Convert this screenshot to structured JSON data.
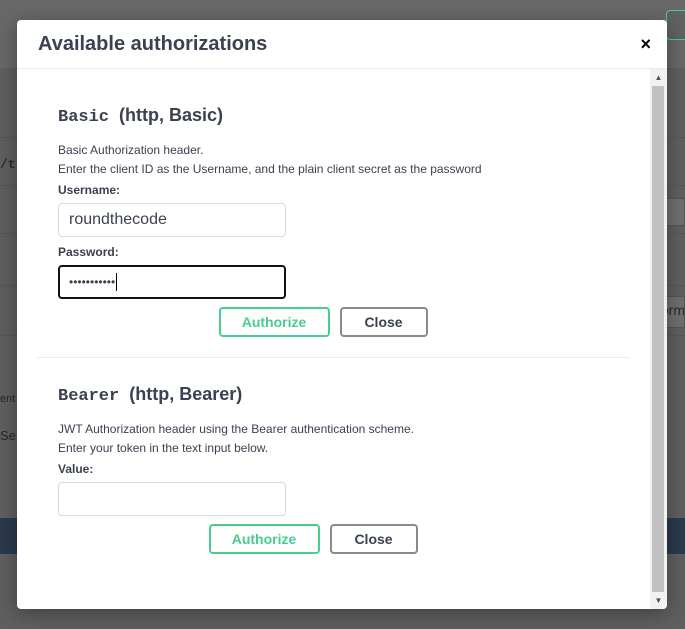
{
  "modal": {
    "title": "Available authorizations",
    "close_glyph": "×"
  },
  "basic": {
    "scheme_name": "Basic",
    "scheme_info": "(http, Basic)",
    "description_1": "Basic Authorization header.",
    "description_2": "Enter the client ID as the Username, and the plain client secret as the password",
    "username_label": "Username:",
    "username_value": "roundthecode",
    "password_label": "Password:",
    "password_mask": "•••••••••••",
    "authorize_label": "Authorize",
    "close_label": "Close"
  },
  "bearer": {
    "scheme_name": "Bearer",
    "scheme_info": "(http, Bearer)",
    "description_1": "JWT Authorization header using the Bearer authentication scheme.",
    "description_2": "Enter your token in the text input below.",
    "value_label": "Value:",
    "value_value": "",
    "authorize_label": "Authorize",
    "close_label": "Close"
  },
  "background": {
    "frag_path": "/t",
    "frag_orm": "orm",
    "frag_ent": "ent",
    "frag_se": "Se"
  },
  "colors": {
    "accent_green": "#49cc90",
    "text": "#3b4151",
    "overlay": "#5f5f5f"
  }
}
